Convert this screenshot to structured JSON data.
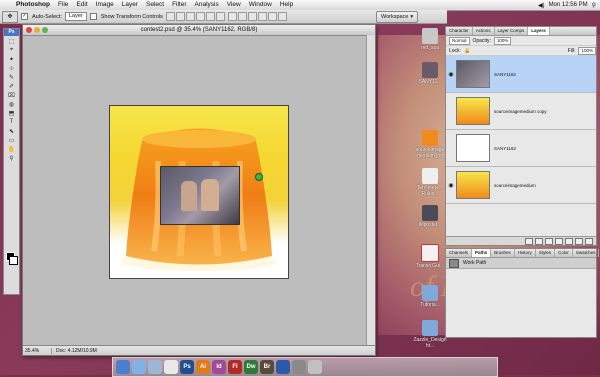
{
  "menubar": {
    "apple": "",
    "items": [
      "Photoshop",
      "File",
      "Edit",
      "Image",
      "Layer",
      "Select",
      "Filter",
      "Analysis",
      "View",
      "Window",
      "Help"
    ],
    "clock": "Mon 12:56 PM"
  },
  "options": {
    "auto_select_label": "Auto-Select:",
    "auto_select_value": "Layer",
    "transform_label": "Show Transform Controls",
    "workspace_label": "Workspace"
  },
  "toolbox": {
    "header": "Ps",
    "tools": [
      "⬚",
      "⌖",
      "✦",
      "⊹",
      "✎",
      "✐",
      "⌧",
      "◍",
      "⬒",
      "T",
      "⬉",
      "▭",
      "✋",
      "⚲"
    ]
  },
  "document": {
    "title": "contest2.psd @ 35.4% (SANY1162, RGB/8)",
    "zoom": "35.4%",
    "doc_info": "Doc: 4.12M/10.9M"
  },
  "desktop_icons": [
    {
      "label": "red_spa"
    },
    {
      "label": "SANY11..."
    },
    {
      "label": "sourceimage medium.jpg"
    },
    {
      "label": "Ten Intere... Rules..."
    },
    {
      "label": "Iklposter..."
    },
    {
      "label": "Transit Gui..."
    },
    {
      "label": "Tutoria..."
    },
    {
      "label": "Zazzle_Design ht..."
    }
  ],
  "layers_panel": {
    "tabs": [
      "Character",
      "Actions",
      "Layer Comps",
      "Layers"
    ],
    "active_tab": "Layers",
    "blend_mode": "Normal",
    "opacity_label": "Opacity:",
    "opacity_value": "100%",
    "lock_label": "Lock:",
    "fill_label": "Fill:",
    "fill_value": "100%",
    "layers": [
      {
        "name": "SANY1162",
        "selected": true
      },
      {
        "name": "sourceimagemedium copy",
        "selected": false
      },
      {
        "name": "SANY1162",
        "selected": false
      },
      {
        "name": "sourceimagemedium",
        "selected": false
      }
    ]
  },
  "paths_panel": {
    "tabs": [
      "Channels",
      "Paths",
      "Brushes",
      "History",
      "Styles",
      "Color",
      "Swatches"
    ],
    "active_tab": "Paths",
    "path_item": "Work Path"
  },
  "dock": {
    "apps": [
      "Finder",
      "Safari",
      "Mail",
      "iCal",
      "Ps",
      "Ai",
      "Id",
      "Fl",
      "Dw",
      "Br",
      "Word",
      "Prefs",
      "Trash"
    ]
  },
  "colors": {
    "accent": "#4a74c9",
    "desktop": "#7b2e4c",
    "jelly": "#f08a1c"
  }
}
